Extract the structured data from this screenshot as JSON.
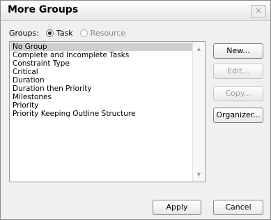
{
  "dialog": {
    "title": "More Groups",
    "close_symbol": "×"
  },
  "groups": {
    "label": "Groups:",
    "options": [
      {
        "label": "Task",
        "checked": true
      },
      {
        "label": "Resource",
        "checked": false
      }
    ]
  },
  "list": {
    "items": [
      "No Group",
      "Complete and Incomplete Tasks",
      "Constraint Type",
      "Critical",
      "Duration",
      "Duration then Priority",
      "Milestones",
      "Priority",
      "Priority Keeping Outline Structure"
    ],
    "selected_index": 0
  },
  "scrollbar": {
    "up_symbol": "▲",
    "down_symbol": "▼"
  },
  "buttons": {
    "new": "New...",
    "edit": "Edit...",
    "copy": "Copy...",
    "organizer": "Organizer...",
    "apply": "Apply",
    "cancel": "Cancel"
  }
}
